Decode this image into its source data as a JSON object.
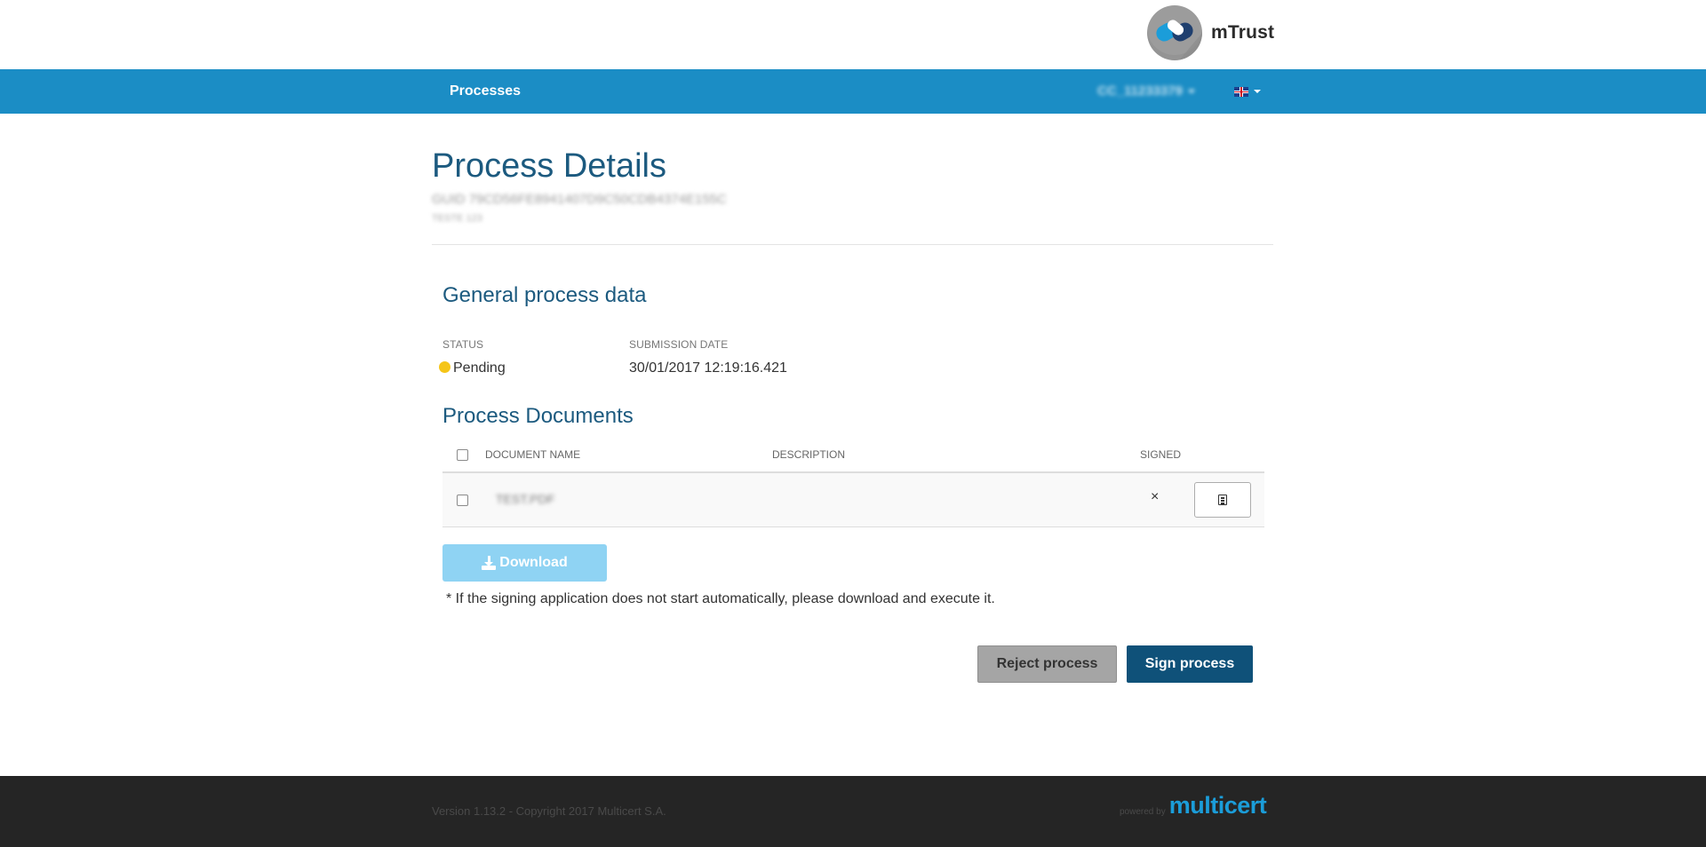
{
  "header": {
    "brand": "mTrust"
  },
  "navbar": {
    "processes_label": "Processes",
    "user_label": "CC_11233379",
    "language": "English"
  },
  "page": {
    "title": "Process Details",
    "guid": "GUID 79CD56FE8941407D9C50CDB4374E155C",
    "subtitle": "TESTE 123"
  },
  "general": {
    "title": "General process data",
    "status_label": "STATUS",
    "status_value": "Pending",
    "submission_label": "SUBMISSION DATE",
    "submission_value": "30/01/2017 12:19:16.421"
  },
  "documents": {
    "title": "Process Documents",
    "columns": [
      "DOCUMENT NAME",
      "DESCRIPTION",
      "SIGNED"
    ],
    "rows": [
      {
        "name": "TEST.PDF",
        "description": "",
        "signed": "×"
      }
    ]
  },
  "download": {
    "label": "Download",
    "note": "* If the signing application does not start automatically, please download and execute it."
  },
  "actions": {
    "reject_label": "Reject process",
    "sign_label": "Sign process"
  },
  "footer": {
    "version": "Version 1.13.2 - Copyright 2017 Multicert S.A.",
    "powered_by": "powered by",
    "brand": "multicert"
  },
  "colors": {
    "navbar": "#1b8dc5",
    "heading": "#1c5a7f",
    "status_pending": "#f5c518",
    "download_button": "#8fd3f3",
    "sign_button": "#0f5179",
    "reject_button": "#a5a5a5",
    "footer": "#252525",
    "footer_brand": "#1b9dd9"
  }
}
